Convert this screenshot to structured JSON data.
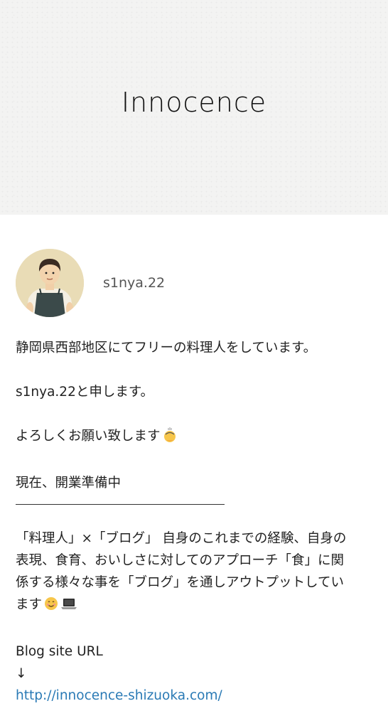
{
  "header": {
    "title": "Innocence"
  },
  "profile": {
    "username": "s1nya.22",
    "avatar_desc": "avatar"
  },
  "bio": {
    "line1": "静岡県西部地区にてフリーの料理人をしています。",
    "line2": "s1nya.22と申します。",
    "line3": "よろしくお願い致します",
    "line4": "現在、開業準備中",
    "para_line1": "「料理人」×「ブログ」 自身のこれまでの経験、自身の",
    "para_line2": "表現、食育、おいしさに対してのアプローチ「食」に関",
    "para_line3": "係する様々な事を「ブログ」を通しアウトプットしてい",
    "para_line4": "ます",
    "blog_label": "Blog site URL",
    "arrow": "↓",
    "url": "http://innocence-shizuoka.com/"
  },
  "colors": {
    "link": "#2a7ab5",
    "header_bg": "#f3f3f2"
  }
}
